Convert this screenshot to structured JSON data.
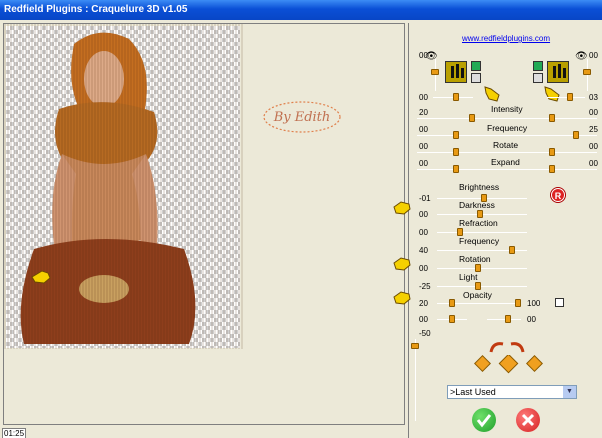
{
  "title": "Redfield Plugins : Craquelure 3D  v1.05",
  "link": "www.redfieldplugins.com",
  "watermark": "By Edith",
  "zoom": "01:25",
  "top_values": {
    "left_top": "00",
    "right_top": "00",
    "left_mid": "00",
    "right_mid": "03"
  },
  "sliders": {
    "intensity": {
      "label": "Intensity",
      "left": "20",
      "right": "00"
    },
    "frequency": {
      "label": "Frequency",
      "left": "00",
      "right": "25"
    },
    "rotate": {
      "label": "Rotate",
      "left": "00",
      "right": "00"
    },
    "expand": {
      "label": "Expand",
      "left": "00",
      "right": "00"
    }
  },
  "lower": {
    "brightness": {
      "label": "Brightness",
      "value": "-01"
    },
    "darkness": {
      "label": "Darkness",
      "value": "00"
    },
    "refraction": {
      "label": "Refraction",
      "value": "00"
    },
    "frequency": {
      "label": "Frequency",
      "value": "40"
    },
    "rotation": {
      "label": "Rotation",
      "value": "00"
    },
    "light": {
      "label": "Light",
      "value": "-25"
    },
    "opacity": {
      "label": "Opacity",
      "value": "20",
      "right": "100"
    },
    "last_row": {
      "left": "00",
      "right": "00"
    },
    "vertical": "-50"
  },
  "preset": {
    "selected": ">Last Used"
  },
  "icons": {
    "ok": "check-icon",
    "cancel": "close-icon",
    "random": "random-r-icon"
  },
  "colors": {
    "accent": "#E89A14",
    "titlebar": "#0A4FD6",
    "ok": "#1E9E2A",
    "cancel": "#D42020"
  }
}
